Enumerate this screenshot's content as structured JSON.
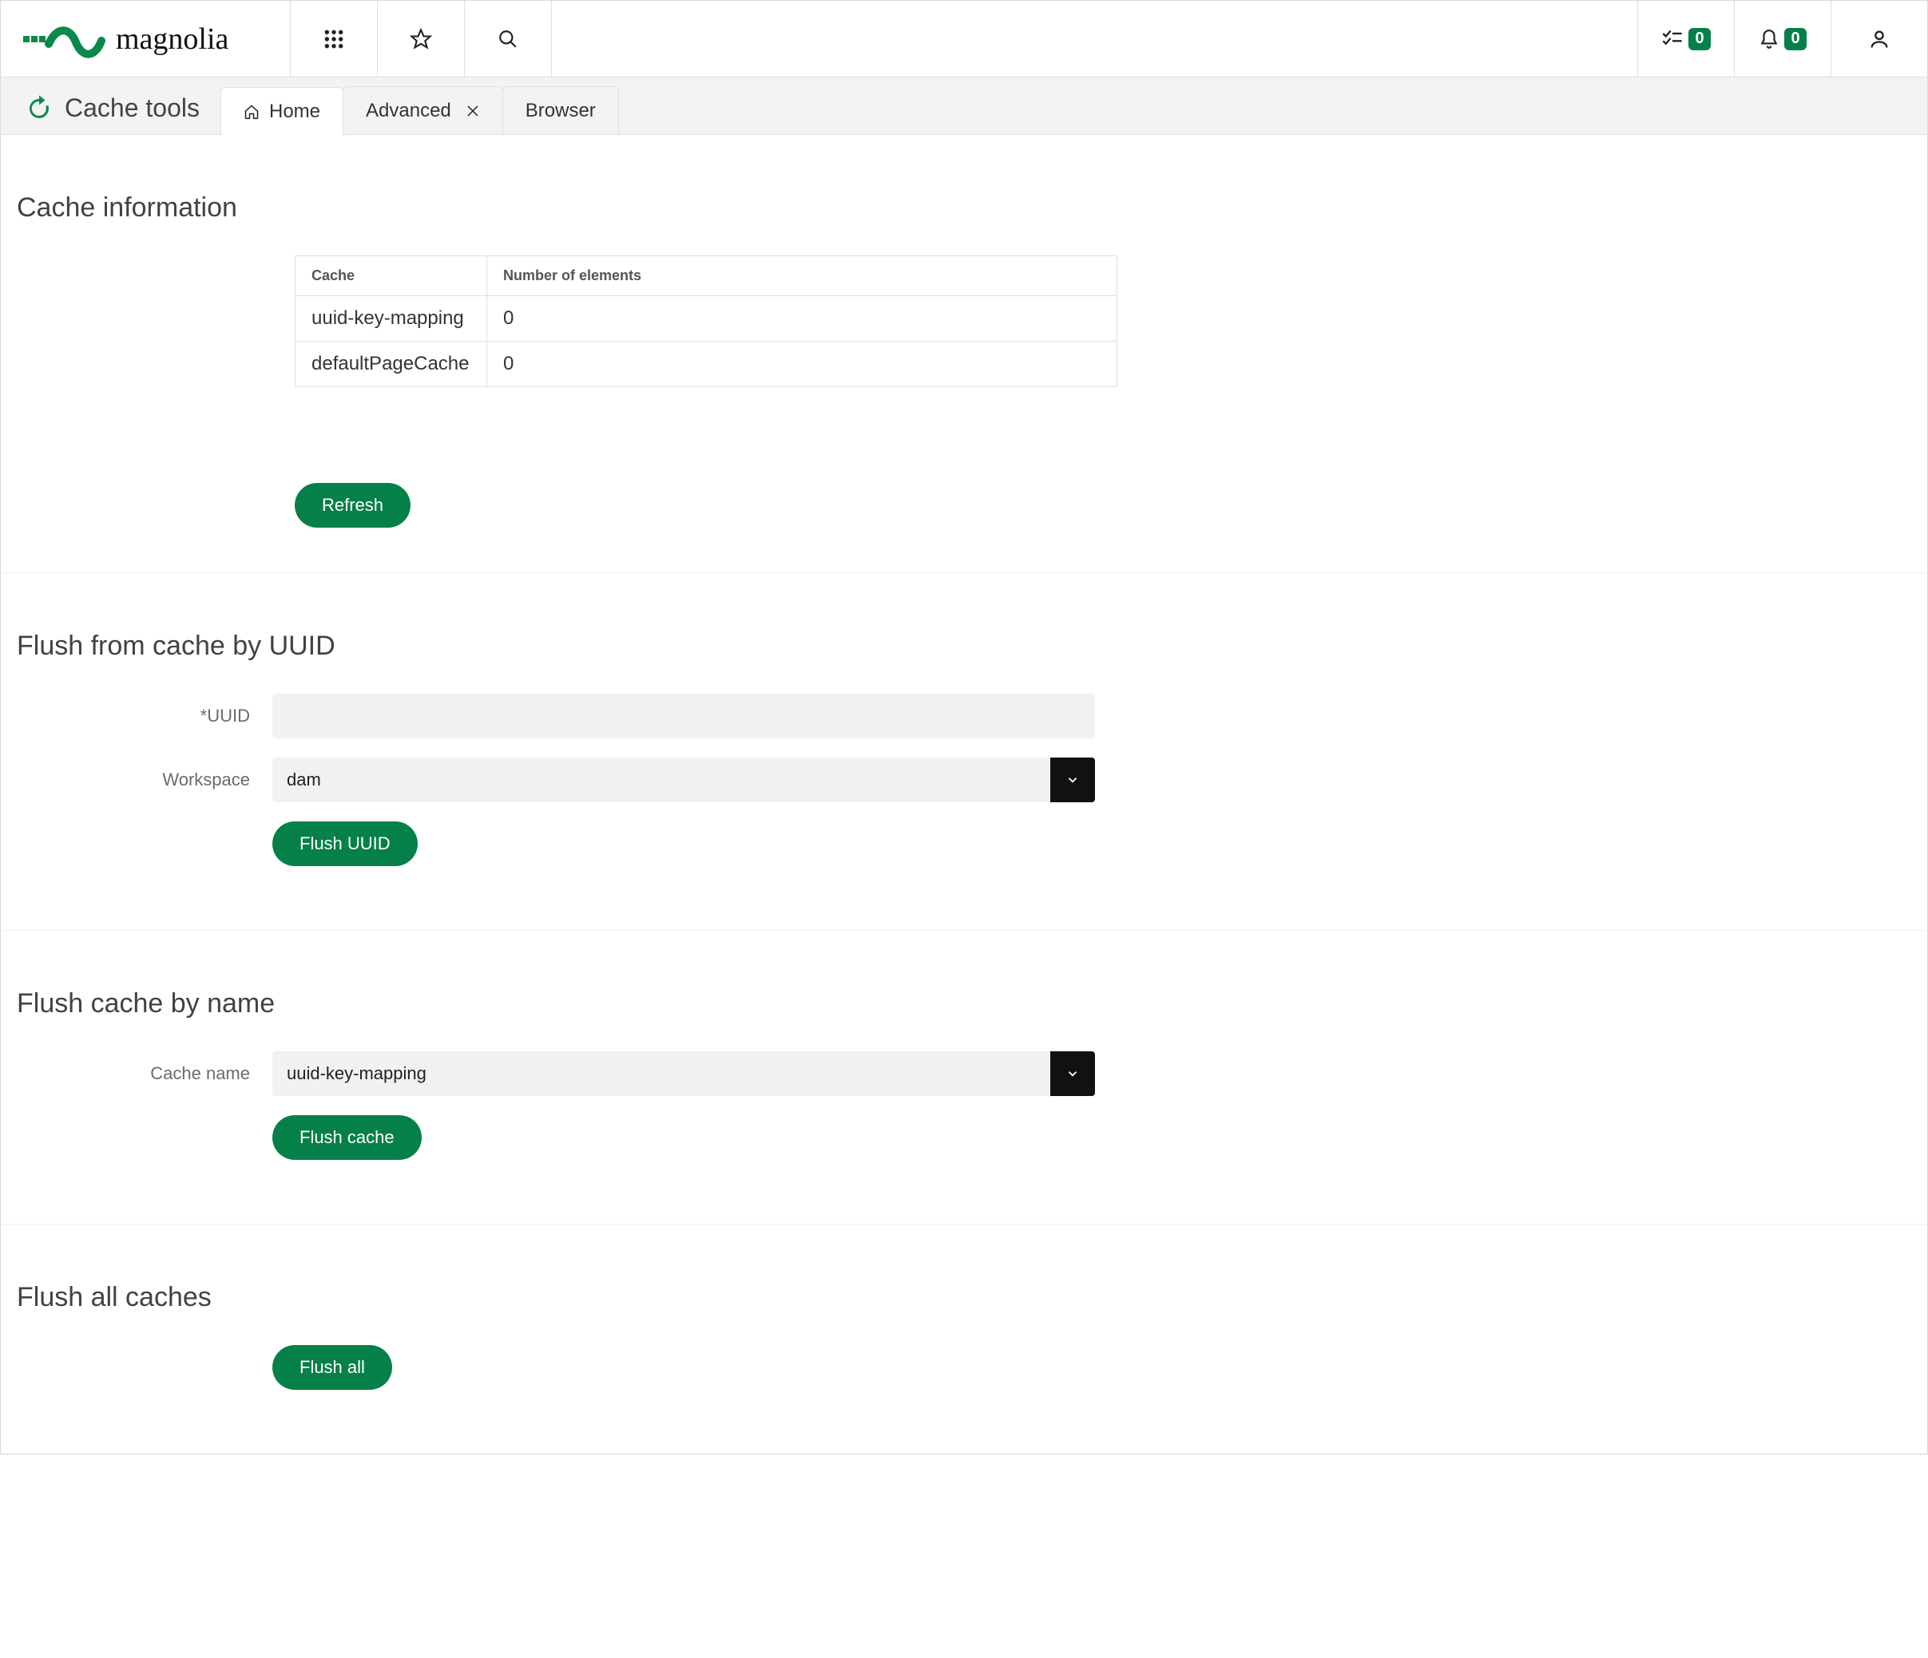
{
  "header": {
    "tasks_count": "0",
    "notifications_count": "0"
  },
  "app": {
    "title": "Cache tools",
    "tabs": [
      {
        "label": "Home",
        "has_icon": true
      },
      {
        "label": "Advanced",
        "closable": true
      },
      {
        "label": "Browser"
      }
    ]
  },
  "sections": {
    "cache_info": {
      "title": "Cache information",
      "table": {
        "headers": [
          "Cache",
          "Number of elements"
        ],
        "rows": [
          {
            "name": "uuid-key-mapping",
            "count": "0"
          },
          {
            "name": "defaultPageCache",
            "count": "0"
          }
        ]
      },
      "refresh_label": "Refresh"
    },
    "flush_uuid": {
      "title": "Flush from cache by UUID",
      "uuid_label": "*UUID",
      "uuid_value": "",
      "workspace_label": "Workspace",
      "workspace_value": "dam",
      "button_label": "Flush UUID"
    },
    "flush_name": {
      "title": "Flush cache by name",
      "name_label": "Cache name",
      "name_value": "uuid-key-mapping",
      "button_label": "Flush cache"
    },
    "flush_all": {
      "title": "Flush all caches",
      "button_label": "Flush all"
    }
  }
}
